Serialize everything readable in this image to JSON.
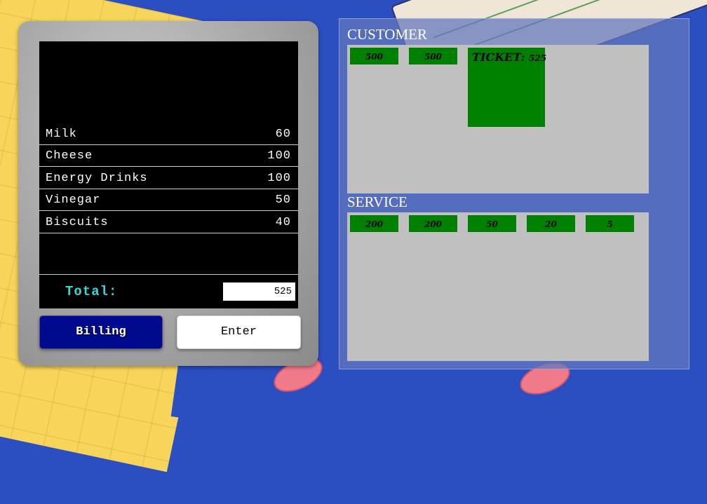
{
  "bill": {
    "items": [
      {
        "name": "Milk",
        "price": "60"
      },
      {
        "name": "Cheese",
        "price": "100"
      },
      {
        "name": "Energy Drinks",
        "price": "100"
      },
      {
        "name": "Vinegar",
        "price": "50"
      },
      {
        "name": "Biscuits",
        "price": "40"
      }
    ],
    "total_label": "Total:",
    "total_value": "525"
  },
  "buttons": {
    "billing": "Billing",
    "enter": "Enter"
  },
  "customer": {
    "title": "CUSTOMER",
    "notes": [
      "500",
      "500"
    ],
    "ticket_label": "TICKET:",
    "ticket_amount": "525"
  },
  "service": {
    "title": "SERVICE",
    "notes": [
      "200",
      "200",
      "50",
      "20",
      "5"
    ]
  },
  "colors": {
    "money_chip": "#008000",
    "billing_button": "#000a8e",
    "total_label": "#37d6d9",
    "background": "#2b4ec0"
  }
}
